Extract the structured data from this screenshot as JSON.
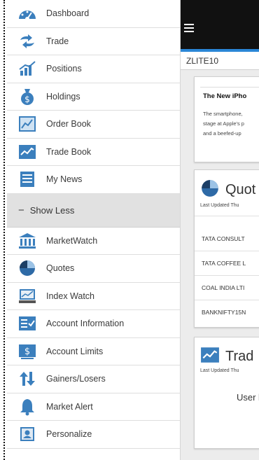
{
  "sidebar": {
    "items": [
      {
        "label": "Dashboard",
        "icon": "dashboard-gauge-icon"
      },
      {
        "label": "Trade",
        "icon": "trade-arrows-icon"
      },
      {
        "label": "Positions",
        "icon": "positions-chart-icon"
      },
      {
        "label": "Holdings",
        "icon": "holdings-moneybag-icon"
      },
      {
        "label": "Order Book",
        "icon": "order-book-chart-icon"
      },
      {
        "label": "Trade Book",
        "icon": "trade-book-chart-icon"
      },
      {
        "label": "My News",
        "icon": "news-list-icon"
      }
    ],
    "show_less": "Show Less",
    "more_items": [
      {
        "label": "MarketWatch",
        "icon": "marketwatch-bank-icon"
      },
      {
        "label": "Quotes",
        "icon": "quotes-pie-icon"
      },
      {
        "label": "Index Watch",
        "icon": "index-watch-monitor-icon"
      },
      {
        "label": "Account Information",
        "icon": "account-info-icon"
      },
      {
        "label": "Account Limits",
        "icon": "account-limits-dollar-icon"
      },
      {
        "label": "Gainers/Losers",
        "icon": "gainers-losers-arrows-icon"
      },
      {
        "label": "Market Alert",
        "icon": "market-alert-bell-icon"
      },
      {
        "label": "Personalize",
        "icon": "personalize-user-icon"
      }
    ]
  },
  "header": {
    "title": "ZLITE10"
  },
  "news": {
    "title": "The New iPho",
    "lines": [
      "The smartphone,",
      "stage at Apple's p",
      "and a beefed-up"
    ]
  },
  "quotes": {
    "title": "Quot",
    "updated": "Last Updated Thu",
    "rows": [
      "TATA CONSULT",
      "TATA COFFEE L",
      "COAL INDIA LTI",
      "BANKNIFTY15N"
    ]
  },
  "trade": {
    "title": "Trad",
    "updated": "Last Updated Thu",
    "user_text": "User l"
  },
  "colors": {
    "accent_blue": "#2a86d6",
    "topbar": "#111111",
    "icon_blue": "#3b7fbd"
  }
}
